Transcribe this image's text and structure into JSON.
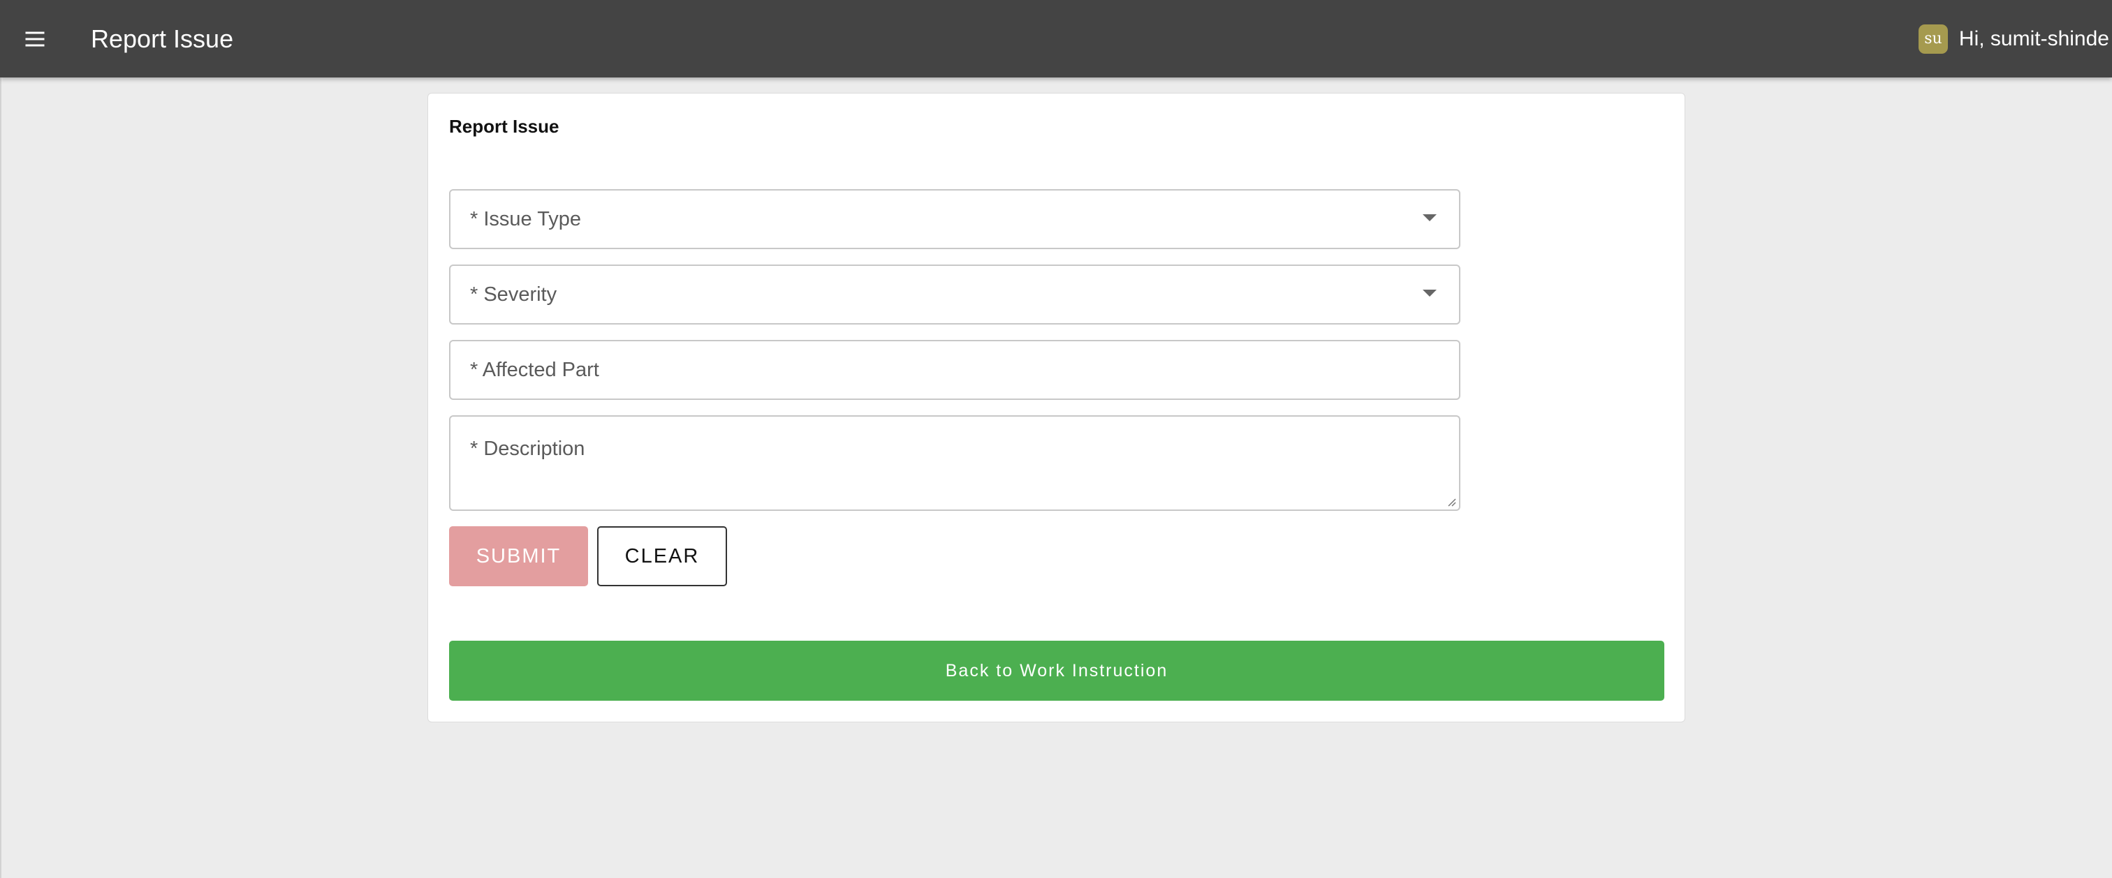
{
  "appbar": {
    "menu_icon": "menu-icon",
    "title": "Report Issue",
    "avatar_initials": "su",
    "greeting": "Hi, sumit-shinde"
  },
  "form": {
    "card_title": "Report Issue",
    "issue_type": {
      "placeholder": "* Issue Type",
      "value": ""
    },
    "severity": {
      "placeholder": "* Severity",
      "value": ""
    },
    "affected_part": {
      "placeholder": "* Affected Part",
      "value": ""
    },
    "description": {
      "placeholder": "* Description",
      "value": ""
    },
    "submit_label": "SUBMIT",
    "clear_label": "CLEAR",
    "back_label": "Back to Work Instruction"
  },
  "colors": {
    "appbar_bg": "#444444",
    "page_bg": "#ececec",
    "submit_disabled": "#e39e9f",
    "back_green": "#4caf50",
    "avatar_bg": "#a59a4f"
  }
}
